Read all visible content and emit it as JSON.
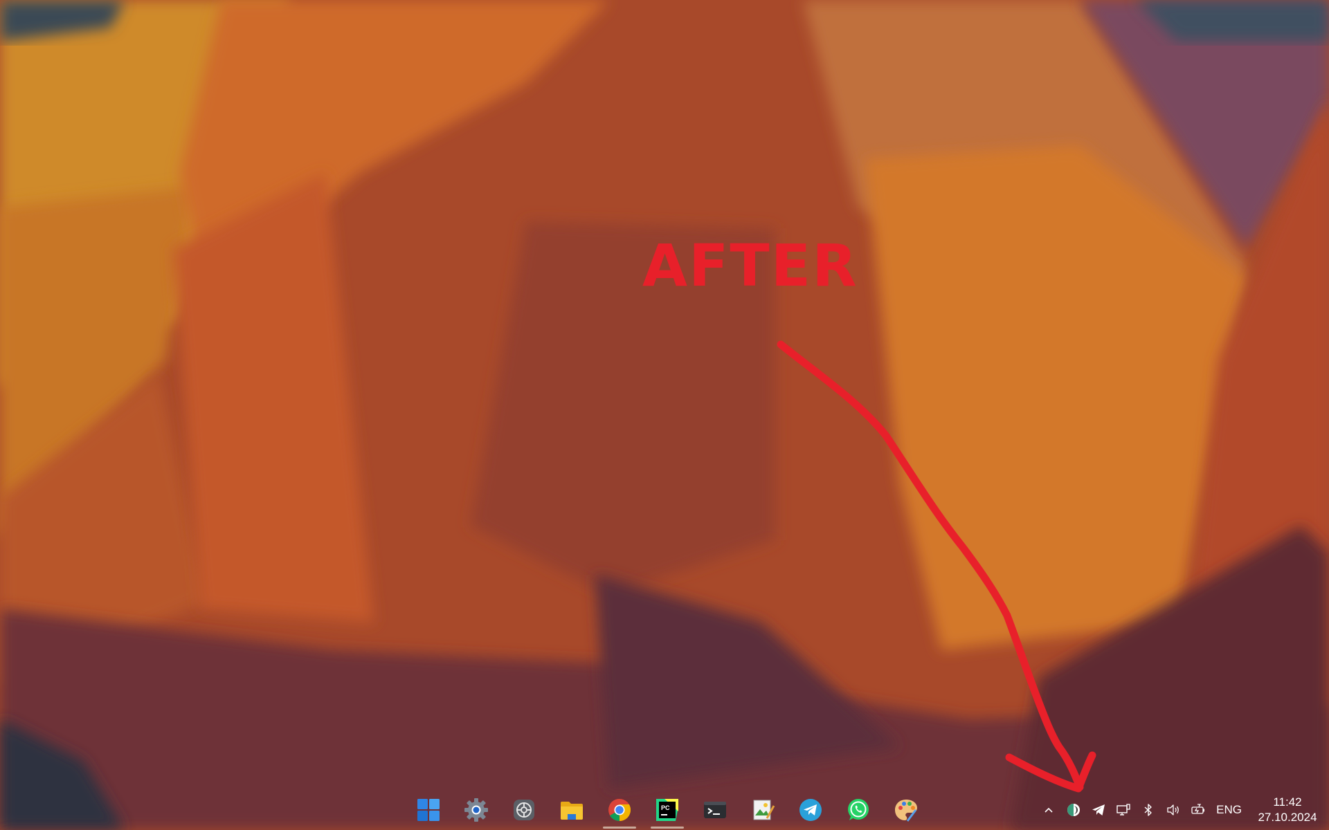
{
  "annotation": {
    "text": "AFTER",
    "color": "#e8202a"
  },
  "taskbar": {
    "apps": [
      {
        "name": "start-button",
        "icon": "windows-logo-icon",
        "running": false
      },
      {
        "name": "settings-app",
        "icon": "gear-icon",
        "running": false
      },
      {
        "name": "system-app",
        "icon": "dial-settings-icon",
        "running": false
      },
      {
        "name": "file-explorer-app",
        "icon": "folder-icon",
        "running": false
      },
      {
        "name": "chrome-app",
        "icon": "chrome-icon",
        "running": true
      },
      {
        "name": "pycharm-app",
        "icon": "pycharm-icon",
        "label": "PC",
        "running": true
      },
      {
        "name": "terminal-app",
        "icon": "terminal-icon",
        "running": false
      },
      {
        "name": "image-editor-app",
        "icon": "picture-edit-icon",
        "running": false
      },
      {
        "name": "telegram-app",
        "icon": "telegram-icon",
        "running": false
      },
      {
        "name": "whatsapp-app",
        "icon": "whatsapp-icon",
        "running": false
      },
      {
        "name": "paint-app",
        "icon": "palette-icon",
        "running": false
      }
    ],
    "tray": {
      "icons": [
        "chevron-up-icon",
        "half-circle-theme-icon",
        "telegram-tray-icon",
        "network-display-icon",
        "bluetooth-icon",
        "volume-icon",
        "battery-charging-icon"
      ],
      "language": "ENG",
      "time": "11:42",
      "date": "27.10.2024"
    }
  }
}
